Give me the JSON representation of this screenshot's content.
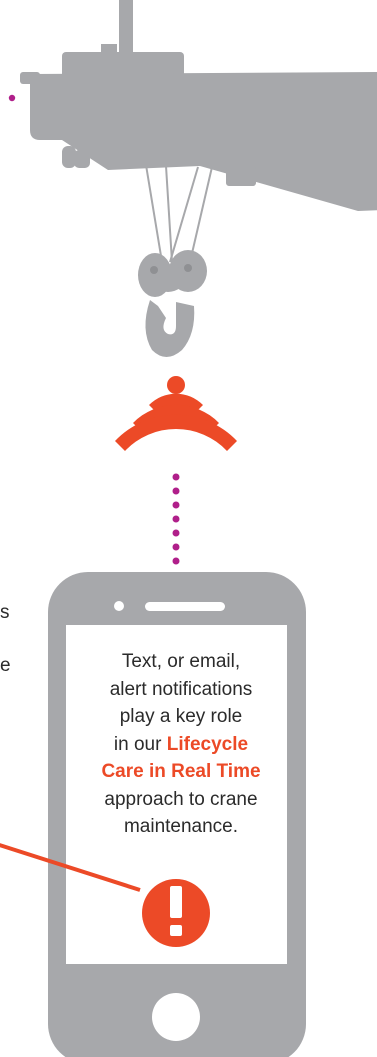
{
  "colors": {
    "crane_gray": "#a7a8ab",
    "crane_dark": "#96979a",
    "accent_orange": "#ec4a27",
    "dotted_magenta": "#b01f8a",
    "phone_body": "#a7a8ab",
    "phone_screen": "#ffffff",
    "text": "#2b2b2b"
  },
  "icons": {
    "crane": "crane-hoist-icon",
    "signal": "wireless-signal-icon",
    "phone": "smartphone-icon",
    "alert": "exclamation-alert-icon"
  },
  "phone_message": {
    "line1": "Text, or email,",
    "line2": "alert notifications",
    "line3": "play a key role",
    "line4_prefix": "in our ",
    "line4_highlight": "Lifecycle",
    "line5_highlight": "Care in Real Time",
    "line6": "approach to crane",
    "line7": "maintenance."
  },
  "cropped_fragments": {
    "frag1": "s",
    "frag2": "e"
  }
}
